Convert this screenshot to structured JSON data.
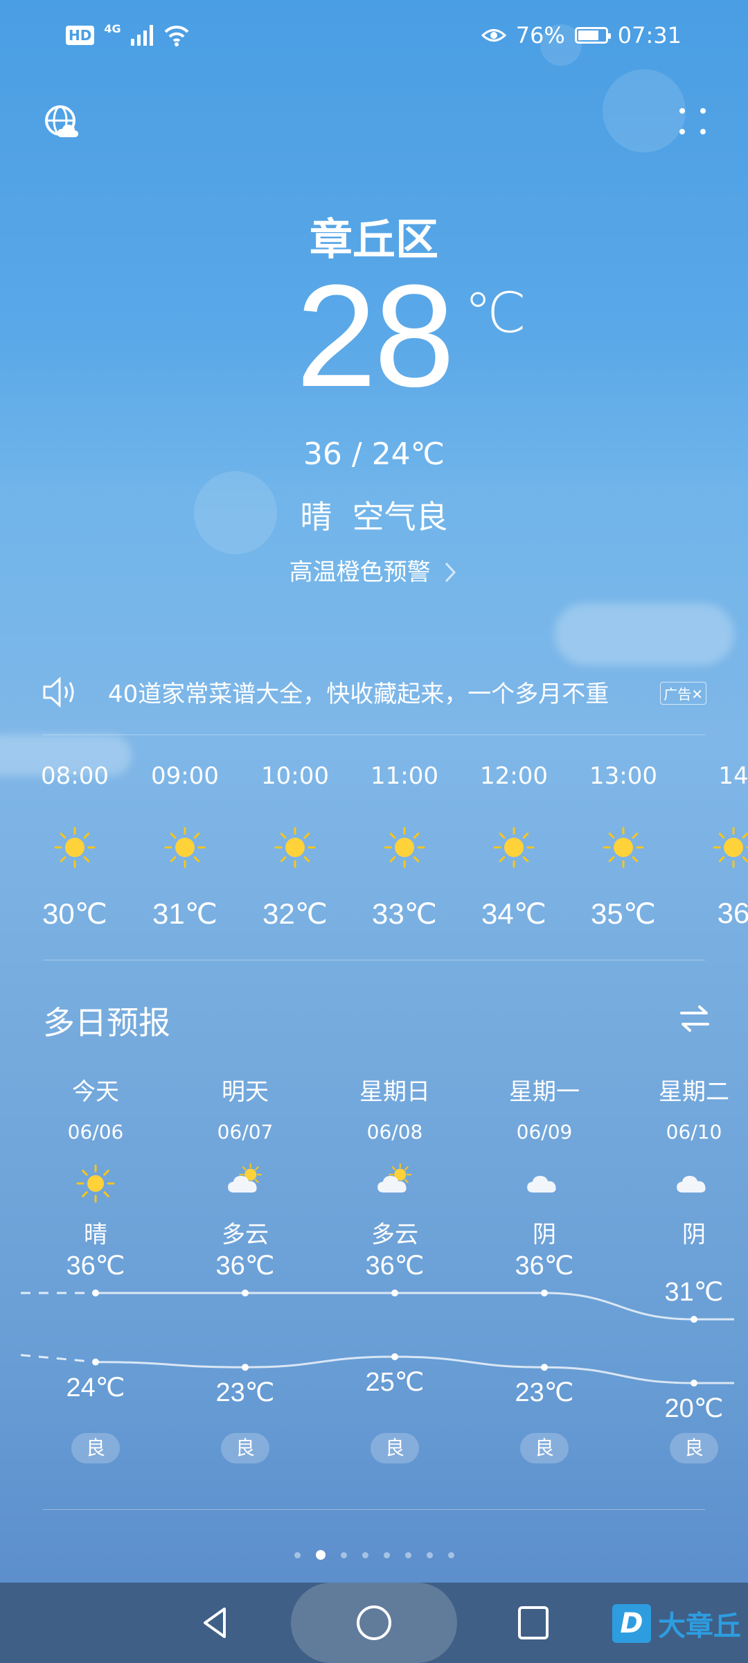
{
  "status_bar": {
    "hd": "HD",
    "network": "4G",
    "battery_percent": "76%",
    "battery_level": 0.76,
    "time": "07:31"
  },
  "current": {
    "city": "章丘区",
    "temperature": "28",
    "unit": "℃",
    "range": "36 / 24℃",
    "condition": "晴  空气良",
    "alert": "高温橙色预警"
  },
  "notice": {
    "text": "40道家常菜谱大全，快收藏起来，一个多月不重",
    "ad_label": "广告",
    "close": "✕"
  },
  "hourly": [
    {
      "time": "08:00",
      "icon": "sun-icon",
      "temp": "30℃"
    },
    {
      "time": "09:00",
      "icon": "sun-icon",
      "temp": "31℃"
    },
    {
      "time": "10:00",
      "icon": "sun-icon",
      "temp": "32℃"
    },
    {
      "time": "11:00",
      "icon": "sun-icon",
      "temp": "33℃"
    },
    {
      "time": "12:00",
      "icon": "sun-icon",
      "temp": "34℃"
    },
    {
      "time": "13:00",
      "icon": "sun-icon",
      "temp": "35℃"
    },
    {
      "time": "14",
      "icon": "sun-icon",
      "temp": "36"
    }
  ],
  "forecast": {
    "title": "多日预报",
    "days": [
      {
        "name": "今天",
        "date": "06/06",
        "icon": "sun-icon",
        "cond": "晴",
        "high": "36℃",
        "low": "24℃",
        "aq": "良",
        "high_val": 36,
        "low_val": 24
      },
      {
        "name": "明天",
        "date": "06/07",
        "icon": "partly-cloudy-icon",
        "cond": "多云",
        "high": "36℃",
        "low": "23℃",
        "aq": "良",
        "high_val": 36,
        "low_val": 23
      },
      {
        "name": "星期日",
        "date": "06/08",
        "icon": "partly-cloudy-icon",
        "cond": "多云",
        "high": "36℃",
        "low": "25℃",
        "aq": "良",
        "high_val": 36,
        "low_val": 25
      },
      {
        "name": "星期一",
        "date": "06/09",
        "icon": "cloud-icon",
        "cond": "阴",
        "high": "36℃",
        "low": "23℃",
        "aq": "良",
        "high_val": 36,
        "low_val": 23
      },
      {
        "name": "星期二",
        "date": "06/10",
        "icon": "cloud-icon",
        "cond": "阴",
        "high": "31℃",
        "low": "20℃",
        "aq": "良",
        "high_val": 31,
        "low_val": 20
      }
    ]
  },
  "page_indicator": {
    "count": 8,
    "active": 1
  },
  "watermark": {
    "logo": "D",
    "name": "大章丘"
  }
}
